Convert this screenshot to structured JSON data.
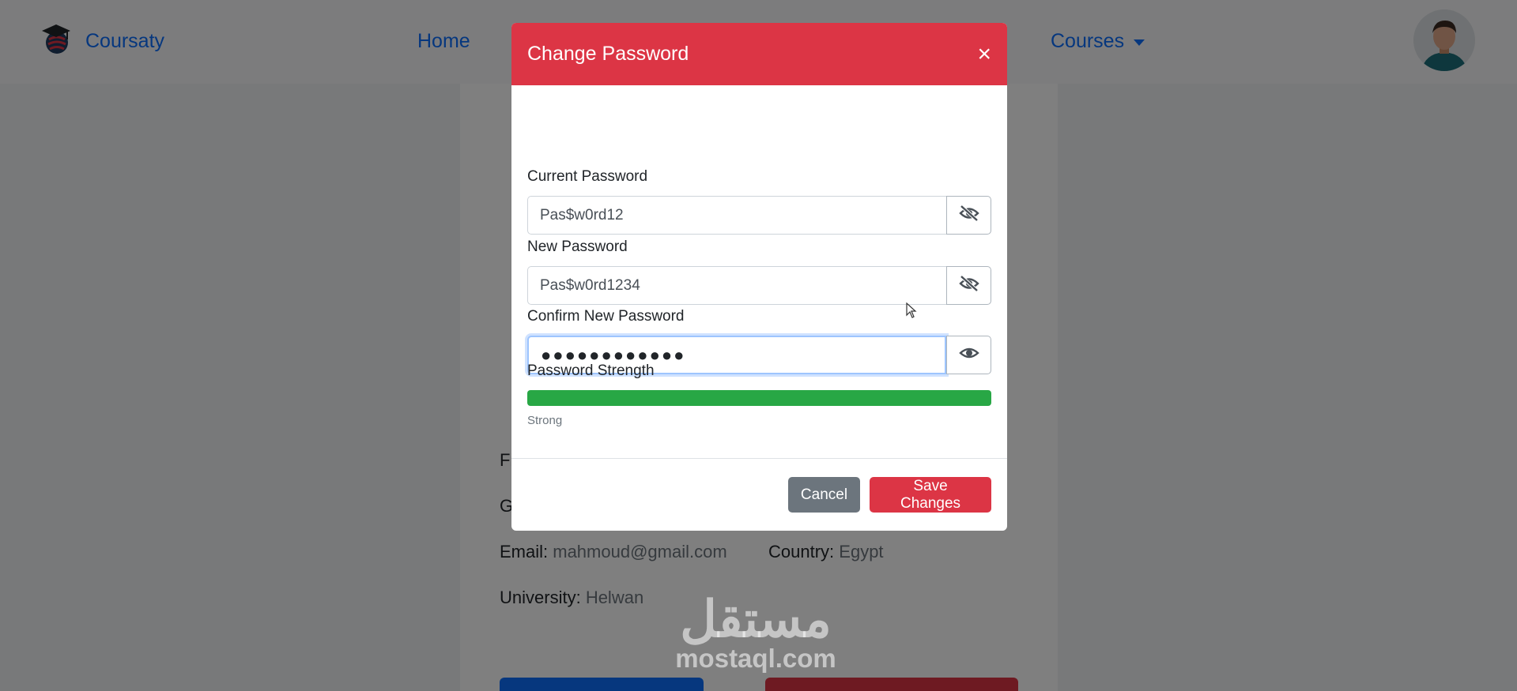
{
  "navbar": {
    "brand": "Coursaty",
    "links": {
      "home": "Home",
      "courses": "Courses"
    }
  },
  "profile": {
    "partial_label_1": "Fi",
    "partial_label_2": "G",
    "email_label": "Email:",
    "email_value": "mahmoud@gmail.com",
    "country_label": "Country:",
    "country_value": "Egypt",
    "university_label": "University:",
    "university_value": "Helwan"
  },
  "modal": {
    "title": "Change Password",
    "close_symbol": "×",
    "fields": {
      "current": {
        "label": "Current Password",
        "value": "Pas$w0rd12"
      },
      "new": {
        "label": "New Password",
        "value": "Pas$w0rd1234"
      },
      "confirm": {
        "label": "Confirm New Password",
        "value": "●●●●●●●●●●●●"
      }
    },
    "strength": {
      "label": "Password Strength",
      "percent": 100,
      "text": "Strong"
    },
    "buttons": {
      "cancel": "Cancel",
      "save": "Save Changes"
    }
  },
  "watermark": {
    "arabic": "مستقل",
    "latin": "mostaql.com"
  },
  "icons": {
    "brand": "graduation-cap-globe-icon",
    "eye_hidden": "eye-slash-icon",
    "eye_visible": "eye-icon",
    "courses_caret": "caret-down-icon"
  },
  "colors": {
    "primary": "#0d6efd",
    "danger": "#dc3545",
    "success": "#28a745",
    "secondary": "#6c757d"
  }
}
